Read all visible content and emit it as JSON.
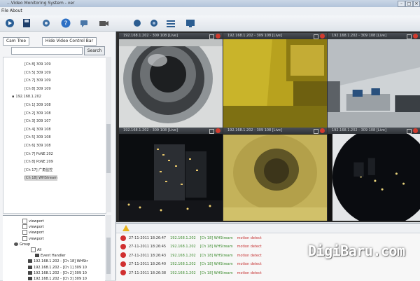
{
  "window": {
    "title": "...Video Monitoring System - ver",
    "controls": [
      "–",
      "□",
      "✕"
    ]
  },
  "menu": {
    "items": [
      "File",
      "About"
    ]
  },
  "toolbar": {
    "icons": [
      "play-icon",
      "save-icon",
      "settings-icon",
      "help-icon",
      "chat-icon",
      "camera-icon",
      "record-icon",
      "layout-icon",
      "display-icon"
    ]
  },
  "left": {
    "tab_cam_tree": "Cam Tree",
    "tab_control": "Hide Video Control Bar",
    "search_button": "Search",
    "tree_top": [
      {
        "label": "[Ch 8] 309 109",
        "indent": 30,
        "sel": false
      },
      {
        "label": "[Ch 5] 309 109",
        "indent": 30,
        "sel": false
      },
      {
        "label": "[Ch 7] 309 109",
        "indent": 30,
        "sel": false
      },
      {
        "label": "[Ch 8] 309 109",
        "indent": 30,
        "sel": false
      },
      {
        "label": "192.168.1.202",
        "indent": 12,
        "sel": false,
        "group": true
      },
      {
        "label": "[Ch 1] 309 108",
        "indent": 30,
        "sel": false
      },
      {
        "label": "[Ch 2] 309 108",
        "indent": 30,
        "sel": false
      },
      {
        "label": "[Ch 3] 309 107",
        "indent": 30,
        "sel": false
      },
      {
        "label": "[Ch 4] 309 108",
        "indent": 30,
        "sel": false
      },
      {
        "label": "[Ch 5] 309 108",
        "indent": 30,
        "sel": false
      },
      {
        "label": "[Ch 6] 309 108",
        "indent": 30,
        "sel": false
      },
      {
        "label": "[Ch 7] PoNE 202",
        "indent": 30,
        "sel": false
      },
      {
        "label": "[Ch 8] PoNE 209",
        "indent": 30,
        "sel": false
      },
      {
        "label": "[Ch 17] 广角监控",
        "indent": 30,
        "sel": false
      },
      {
        "label": "[Ch 18] WHStream",
        "indent": 30,
        "sel": true
      }
    ],
    "tree_bottom": [
      {
        "label": "viewport",
        "indent": 28,
        "kind": "chk"
      },
      {
        "label": "viewport",
        "indent": 28,
        "kind": "chk"
      },
      {
        "label": "viewport",
        "indent": 28,
        "kind": "chk"
      },
      {
        "label": "viewport",
        "indent": 28,
        "kind": "chk"
      },
      {
        "label": "Group",
        "indent": 16,
        "kind": "grp"
      },
      {
        "label": "All",
        "indent": 40,
        "kind": "chk"
      },
      {
        "label": "Event Handler",
        "indent": 46,
        "kind": "cam"
      },
      {
        "label": "192.168.1.202 - [Ch 18] WHStr",
        "indent": 36,
        "kind": "cam"
      },
      {
        "label": "192.168.1.202 - [Ch 1] 309 10",
        "indent": 36,
        "kind": "cam"
      },
      {
        "label": "192.168.1.202 - [Ch 2] 309 10",
        "indent": 36,
        "kind": "cam"
      },
      {
        "label": "192.168.1.202 - [Ch 3] 309 10",
        "indent": 36,
        "kind": "cam"
      }
    ]
  },
  "panels": [
    {
      "label": "192.168.1.202 - 309 108 [Live]"
    },
    {
      "label": "192.168.1.202 - 309 108 [Live]"
    },
    {
      "label": "192.168.1.202 - 309 108 [Live]"
    },
    {
      "label": "192.168.1.202 - 309 108 [Live]"
    },
    {
      "label": "192.168.1.202 - 309 108 [Live]"
    },
    {
      "label": "192.168.1.202 - 309 108 [Live]"
    }
  ],
  "log": {
    "rows": [
      {
        "time": "27-11-2011 18:26:47",
        "ip": "192.168.1.202",
        "ch": "[Ch 18] WHStream",
        "event": "motion detect"
      },
      {
        "time": "27-11-2011 18:26:45",
        "ip": "192.168.1.202",
        "ch": "[Ch 18] WHStream",
        "event": "motion detect"
      },
      {
        "time": "27-11-2011 18:26:43",
        "ip": "192.168.1.202",
        "ch": "[Ch 18] WHStream",
        "event": "motion detect"
      },
      {
        "time": "27-11-2011 18:26:40",
        "ip": "192.168.1.202",
        "ch": "[Ch 18] WHStream",
        "event": "motion detect"
      },
      {
        "time": "27-11-2011 18:26:38",
        "ip": "192.168.1.202",
        "ch": "[Ch 18] WHStream",
        "event": "motion detect"
      }
    ]
  },
  "watermark": "DigiBaru.com",
  "colors": {
    "accent": "#d23b2e",
    "log_green": "#3a8a2c",
    "log_red": "#c53030"
  }
}
